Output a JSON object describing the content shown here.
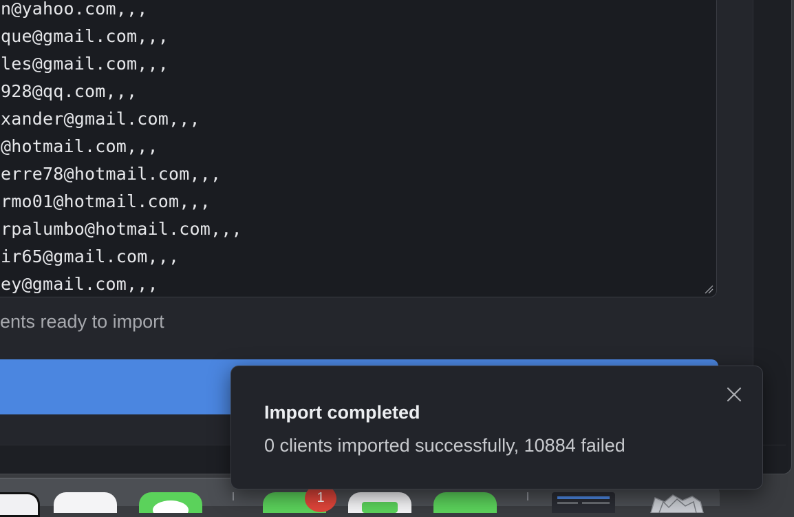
{
  "csv_lines": [
    "n@yahoo.com,,,",
    "que@gmail.com,,,",
    "les@gmail.com,,,",
    "928@qq.com,,,",
    "xander@gmail.com,,,",
    "@hotmail.com,,,",
    "erre78@hotmail.com,,,",
    "rmo01@hotmail.com,,,",
    "rpalumbo@hotmail.com,,,",
    "ir65@gmail.com,,,",
    "ey@gmail.com,,,"
  ],
  "status": {
    "ready_text": "ents ready to import"
  },
  "toast": {
    "title": "Import completed",
    "message": "0 clients imported successfully, 10884 failed"
  },
  "dock": {
    "badge_count": "1",
    "icons": [
      "app-icon",
      "app-icon",
      "messages-icon",
      "app-icon",
      "app-icon",
      "app-icon",
      "app-icon",
      "app-icon"
    ]
  },
  "colors": {
    "accent": "#4b86e0",
    "badge": "#e0453a",
    "background": "#1d1f24"
  }
}
